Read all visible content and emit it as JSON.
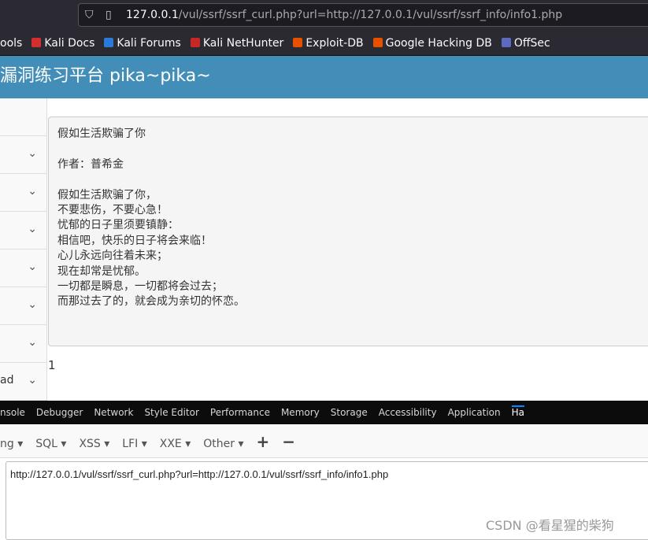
{
  "browser": {
    "url_host": "127.0.0.1",
    "url_path": "/vul/ssrf/ssrf_curl.php?url=http://127.0.0.1/vul/ssrf/ssrf_info/info1.php",
    "bookmarks": [
      {
        "label": "ools",
        "color": ""
      },
      {
        "label": "Kali Docs",
        "color": "#d32f2f"
      },
      {
        "label": "Kali Forums",
        "color": "#2b7bd6"
      },
      {
        "label": "Kali NetHunter",
        "color": "#c62828"
      },
      {
        "label": "Exploit-DB",
        "color": "#e65100"
      },
      {
        "label": "Google Hacking DB",
        "color": "#e65100"
      },
      {
        "label": "OffSec",
        "color": "#5c6bc0"
      }
    ]
  },
  "header": {
    "title": "漏洞练习平台 pika~pika~"
  },
  "sidebar": {
    "items": [
      {
        "label": ""
      },
      {
        "label": ""
      },
      {
        "label": ""
      },
      {
        "label": ""
      },
      {
        "label": ""
      },
      {
        "label": ""
      },
      {
        "label": "ad"
      }
    ]
  },
  "main": {
    "poem": "假如生活欺骗了你\n\n作者：普希金\n\n假如生活欺骗了你，\n不要悲伤，不要心急！\n忧郁的日子里须要镇静：\n相信吧，快乐的日子将会来临！\n心儿永远向往着未来；\n现在却常是忧郁。\n一切都是瞬息，一切都将会过去；\n而那过去了的，就会成为亲切的怀恋。",
    "count": "1"
  },
  "devtools": {
    "tabs": [
      "nsole",
      "Debugger",
      "Network",
      "Style Editor",
      "Performance",
      "Memory",
      "Storage",
      "Accessibility",
      "Application",
      "Ha"
    ],
    "active": 9
  },
  "hackbar": {
    "menus": [
      "ng ▾",
      "SQL ▾",
      "XSS ▾",
      "LFI ▾",
      "XXE ▾",
      "Other ▾"
    ],
    "add": "+",
    "remove": "−",
    "url_value": "http://127.0.0.1/vul/ssrf/ssrf_curl.php?url=http://127.0.0.1/vul/ssrf/ssrf_info/info1.php"
  },
  "watermark": "CSDN @看星猩的柴狗"
}
